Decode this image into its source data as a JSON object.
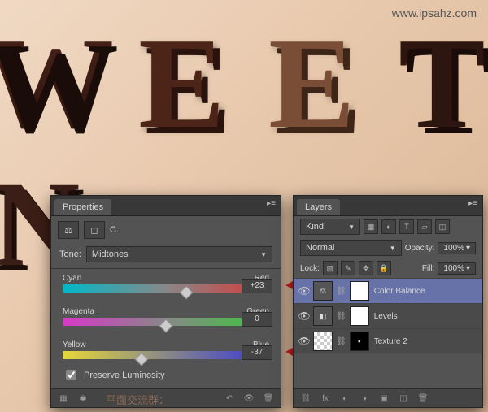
{
  "watermark": "www.ipsahz.com",
  "bottom_text": "平面交流群：",
  "letters": {
    "w": "W",
    "e1": "E",
    "e2": "E",
    "t": "T",
    "n": "N"
  },
  "properties": {
    "tab": "Properties",
    "header": "C.",
    "tone_label": "Tone:",
    "tone_value": "Midtones",
    "sliders": [
      {
        "left": "Cyan",
        "right": "Red",
        "value": "+23"
      },
      {
        "left": "Magenta",
        "right": "Green",
        "value": "0"
      },
      {
        "left": "Yellow",
        "right": "Blue",
        "value": "-37"
      }
    ],
    "preserve": "Preserve Luminosity"
  },
  "layers": {
    "tab": "Layers",
    "kind": "Kind",
    "blend": "Normal",
    "opacity_label": "Opacity:",
    "opacity": "100%",
    "lock": "Lock:",
    "fill_label": "Fill:",
    "fill": "100%",
    "items": [
      {
        "name": "Color Balance",
        "adj": "⚖"
      },
      {
        "name": "Levels",
        "adj": "◧"
      },
      {
        "name": "Texture 2",
        "adj": ""
      }
    ],
    "foot_fx": "fx"
  }
}
